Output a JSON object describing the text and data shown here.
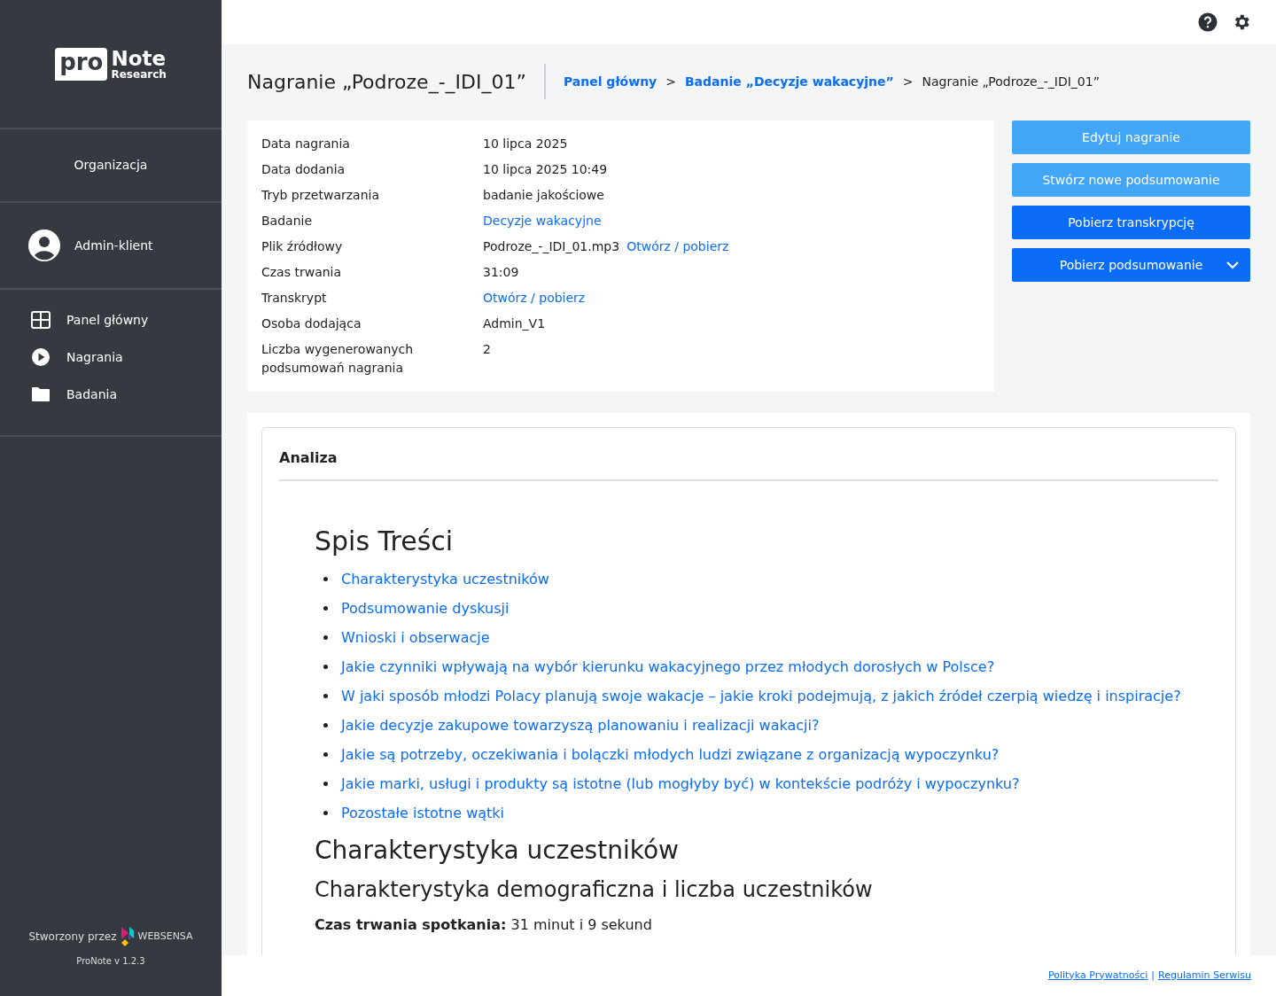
{
  "logo": {
    "badge": "pro",
    "name": "Note",
    "sub": "Research"
  },
  "sidebar": {
    "organization": "Organizacja",
    "user": "Admin-klient",
    "nav": [
      {
        "kind": "dashboard",
        "label": "Panel główny"
      },
      {
        "kind": "recordings",
        "label": "Nagrania"
      },
      {
        "kind": "studies",
        "label": "Badania"
      }
    ],
    "credit": "Stworzony przez",
    "credit_brand": "WEBSENSA",
    "version": "ProNote v 1.2.3"
  },
  "page": {
    "title": "Nagranie „Podroze_-_IDI_01”",
    "breadcrumb": [
      {
        "label": "Panel główny",
        "link": true
      },
      {
        "label": "Badanie „Decyzje wakacyjne”",
        "link": true
      },
      {
        "label": "Nagranie „Podroze_-_IDI_01”",
        "link": false
      }
    ],
    "separator": ">"
  },
  "details": [
    {
      "label": "Data nagrania",
      "parts": [
        {
          "text": "10 lipca 2025",
          "link": false
        }
      ]
    },
    {
      "label": "Data dodania",
      "parts": [
        {
          "text": "10 lipca 2025 10:49",
          "link": false
        }
      ]
    },
    {
      "label": "Tryb przetwarzania",
      "parts": [
        {
          "text": "badanie jakościowe",
          "link": false
        }
      ]
    },
    {
      "label": "Badanie",
      "parts": [
        {
          "text": "Decyzje wakacyjne",
          "link": true
        }
      ]
    },
    {
      "label": "Plik źródłowy",
      "parts": [
        {
          "text": "Podroze_-_IDI_01.mp3",
          "link": false
        },
        {
          "text": "Otwórz / pobierz",
          "link": true
        }
      ]
    },
    {
      "label": "Czas trwania",
      "parts": [
        {
          "text": "31:09",
          "link": false
        }
      ]
    },
    {
      "label": "Transkrypt",
      "parts": [
        {
          "text": "Otwórz / pobierz",
          "link": true
        }
      ]
    },
    {
      "label": "Osoba dodająca",
      "parts": [
        {
          "text": "Admin_V1",
          "link": false
        }
      ]
    },
    {
      "label": "Liczba wygenerowanych podsumowań nagrania",
      "parts": [
        {
          "text": "2",
          "link": false
        }
      ]
    }
  ],
  "actions": [
    {
      "label": "Edytuj nagranie",
      "kind": "light",
      "dropdown": false
    },
    {
      "label": "Stwórz nowe podsumowanie",
      "kind": "light",
      "dropdown": false
    },
    {
      "label": "Pobierz transkrypcję",
      "kind": "primary",
      "dropdown": false
    },
    {
      "label": "Pobierz podsumowanie",
      "kind": "primary",
      "dropdown": true
    }
  ],
  "analysis": {
    "title": "Analiza",
    "toc_title": "Spis Treści",
    "toc": [
      "Charakterystyka uczestników",
      "Podsumowanie dyskusji",
      "Wnioski i obserwacje",
      "Jakie czynniki wpływają na wybór kierunku wakacyjnego przez młodych dorosłych w Polsce?",
      "W jaki sposób młodzi Polacy planują swoje wakacje – jakie kroki podejmują, z jakich źródeł czerpią wiedzę i inspiracje?",
      "Jakie decyzje zakupowe towarzyszą planowaniu i realizacji wakacji?",
      "Jakie są potrzeby, oczekiwania i bolączki młodych ludzi związane z organizacją wypoczynku?",
      "Jakie marki, usługi i produkty są istotne (lub mogłyby być) w kontekście podróży i wypoczynku?",
      "Pozostałe istotne wątki"
    ],
    "h1": "Charakterystyka uczestników",
    "h2": "Charakterystyka demograficzna i liczba uczestników",
    "paragraph": "**Czas trwania spotkania:** 31 minut i 9 sekund"
  },
  "footer": {
    "links": [
      "Polityka Prywatności",
      "Regulamin Serwisu"
    ],
    "separator": "|"
  }
}
